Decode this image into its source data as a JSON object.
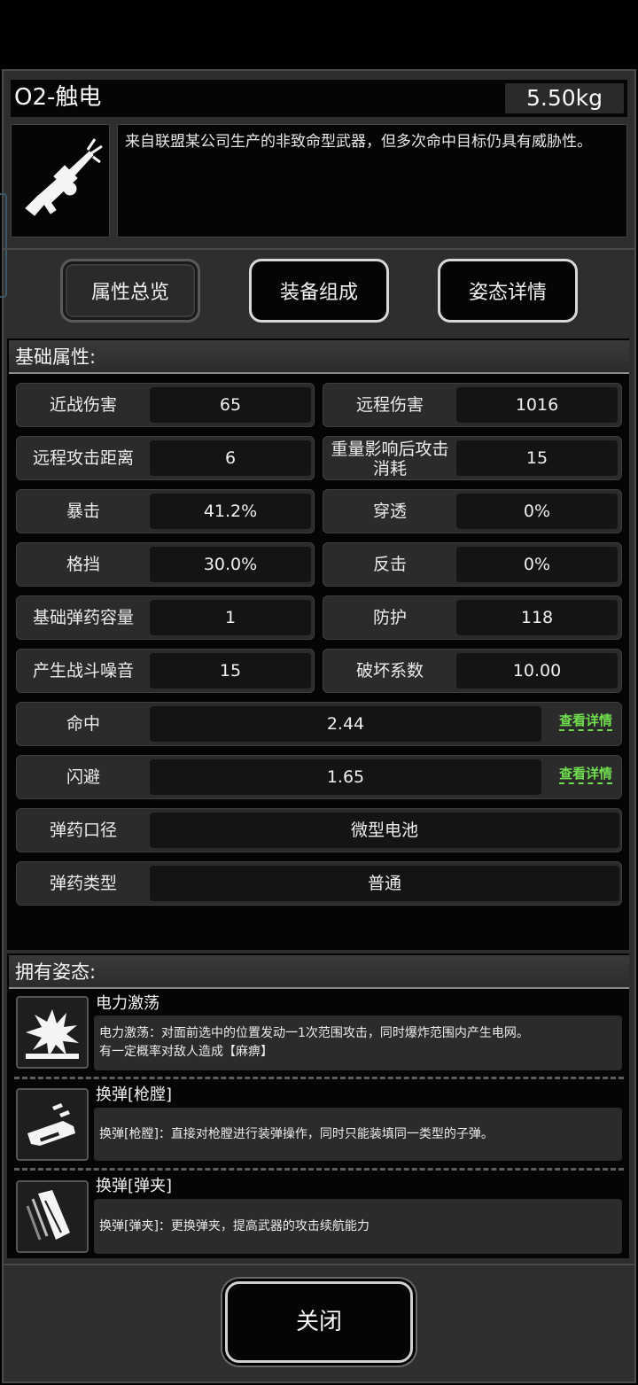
{
  "item": {
    "name": "O2-触电",
    "weight": "5.50kg",
    "description": "来自联盟某公司生产的非致命型武器，但多次命中目标仍具有威胁性。"
  },
  "tabs": [
    {
      "label": "属性总览",
      "state": "inactive"
    },
    {
      "label": "装备组成",
      "state": "active"
    },
    {
      "label": "姿态详情",
      "state": "active"
    }
  ],
  "basic": {
    "header": "基础属性:",
    "pairs": [
      {
        "l1": "近战伤害",
        "v1": "65",
        "l2": "远程伤害",
        "v2": "1016"
      },
      {
        "l1": "远程攻击距离",
        "v1": "6",
        "l2": "重量影响后攻击消耗",
        "v2": "15"
      },
      {
        "l1": "暴击",
        "v1": "41.2%",
        "l2": "穿透",
        "v2": "0%"
      },
      {
        "l1": "格挡",
        "v1": "30.0%",
        "l2": "反击",
        "v2": "0%"
      },
      {
        "l1": "基础弹药容量",
        "v1": "1",
        "l2": "防护",
        "v2": "118"
      },
      {
        "l1": "产生战斗噪音",
        "v1": "15",
        "l2": "破坏系数",
        "v2": "10.00"
      }
    ],
    "full": [
      {
        "label": "命中",
        "value": "2.44",
        "link": "查看详情"
      },
      {
        "label": "闪避",
        "value": "1.65",
        "link": "查看详情"
      },
      {
        "label": "弹药口径",
        "value": "微型电池"
      },
      {
        "label": "弹药类型",
        "value": "普通"
      }
    ]
  },
  "stances": {
    "header": "拥有姿态:",
    "items": [
      {
        "name": "电力激荡",
        "icon": "explosion-icon",
        "desc1": "电力激荡：对面前选中的位置发动一1次范围攻击，同时爆炸范围内产生电网。",
        "desc2": "有一定概率对敌人造成【麻痹】"
      },
      {
        "name": "换弹[枪膛]",
        "icon": "chamber-reload-icon",
        "desc1": "换弹[枪膛]：直接对枪膛进行装弹操作，同时只能装填同一类型的子弹。"
      },
      {
        "name": "换弹[弹夹]",
        "icon": "magazine-reload-icon",
        "desc1": "换弹[弹夹]：更换弹夹，提高武器的攻击续航能力"
      }
    ]
  },
  "close_label": "关闭",
  "colors": {
    "link": "#6fdc4e",
    "panel": "#2e2e2e",
    "dark": "#050505"
  }
}
